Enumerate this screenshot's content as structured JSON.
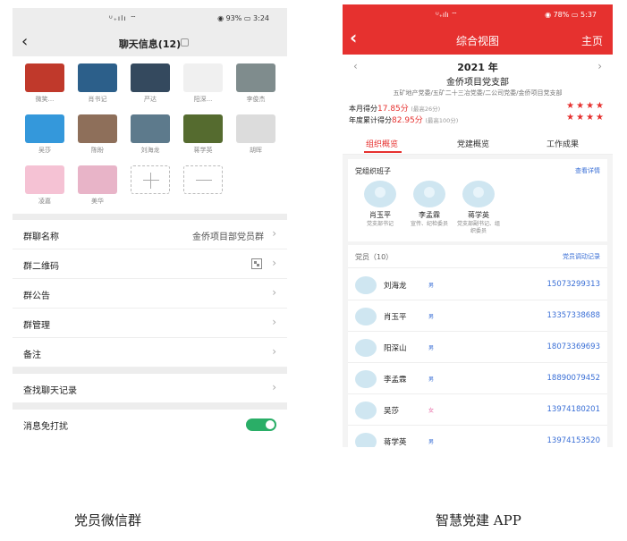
{
  "left": {
    "status": {
      "signal": "ᵁ₊ılı ⌔",
      "battery": "93%",
      "time": "3:24"
    },
    "nav": {
      "back": "‹",
      "title": "聊天信息(12)"
    },
    "members": [
      {
        "name": "微笑...",
        "color": "#c0392b"
      },
      {
        "name": "肖书记",
        "color": "#2c5f8a"
      },
      {
        "name": "严达",
        "color": "#34495e"
      },
      {
        "name": "阳深...",
        "color": "#f0f0f0"
      },
      {
        "name": "李俊杰",
        "color": "#7f8c8d"
      },
      {
        "name": "吴莎",
        "color": "#3498db"
      },
      {
        "name": "陈盼",
        "color": "#8e6f5a"
      },
      {
        "name": "刘海龙",
        "color": "#5d7a8c"
      },
      {
        "name": "蒋学英",
        "color": "#556b2f"
      },
      {
        "name": "胡晖",
        "color": "#dcdcdc"
      },
      {
        "name": "凌嘉",
        "color": "#f5c2d4"
      },
      {
        "name": "美华",
        "color": "#e8b4c8"
      }
    ],
    "rows": {
      "group_name_label": "群聊名称",
      "group_name_value": "金侨项目部党员群",
      "qr_label": "群二维码",
      "notice_label": "群公告",
      "manage_label": "群管理",
      "remark_label": "备注",
      "search_label": "查找聊天记录",
      "mute_label": "消息免打扰"
    },
    "mute_enabled": true
  },
  "right": {
    "status": {
      "signal": "ᵁ₊ılı ⌔",
      "battery": "78%",
      "time": "5:37"
    },
    "nav": {
      "back": "‹",
      "title": "综合视图",
      "home": "主页"
    },
    "summary": {
      "prev": "‹",
      "next": "›",
      "year": "2021 年",
      "branch": "金侨项目党支部",
      "path": "五矿地产党委/五矿二十三冶党委/二公司党委/金侨项目党支部",
      "month_label": "本月得分",
      "month_score": "17.85分",
      "month_note": "(最高26分)",
      "year_label": "年度累计得分",
      "year_score": "82.95分",
      "year_note": "(最高100分)",
      "month_stars": "★★★★",
      "year_stars": "★★★★"
    },
    "tabs": [
      "组织概览",
      "党建概览",
      "工作成果"
    ],
    "committee": {
      "title": "党组织班子",
      "link": "查看详情",
      "leaders": [
        {
          "name": "肖玉平",
          "role": "党支部书记"
        },
        {
          "name": "李孟霖",
          "role": "宣传、纪检委员"
        },
        {
          "name": "蒋学英",
          "role": "党支部副书记、组织委员"
        }
      ]
    },
    "members_head": {
      "title": "党员（10）",
      "link": "党员调动记录"
    },
    "members": [
      {
        "name": "刘海龙",
        "gender": "男",
        "phone": "15073299313",
        "gcolor": "#3a6fd6"
      },
      {
        "name": "肖玉平",
        "gender": "男",
        "phone": "13357338688",
        "gcolor": "#3a6fd6"
      },
      {
        "name": "阳深山",
        "gender": "男",
        "phone": "18073369693",
        "gcolor": "#3a6fd6"
      },
      {
        "name": "李孟霖",
        "gender": "男",
        "phone": "18890079452",
        "gcolor": "#3a6fd6"
      },
      {
        "name": "吴莎",
        "gender": "女",
        "phone": "13974180201",
        "gcolor": "#e86aa6"
      },
      {
        "name": "蒋学英",
        "gender": "男",
        "phone": "13974153520",
        "gcolor": "#3a6fd6"
      }
    ]
  },
  "captions": {
    "left": "党员微信群",
    "right": "智慧党建 APP"
  }
}
